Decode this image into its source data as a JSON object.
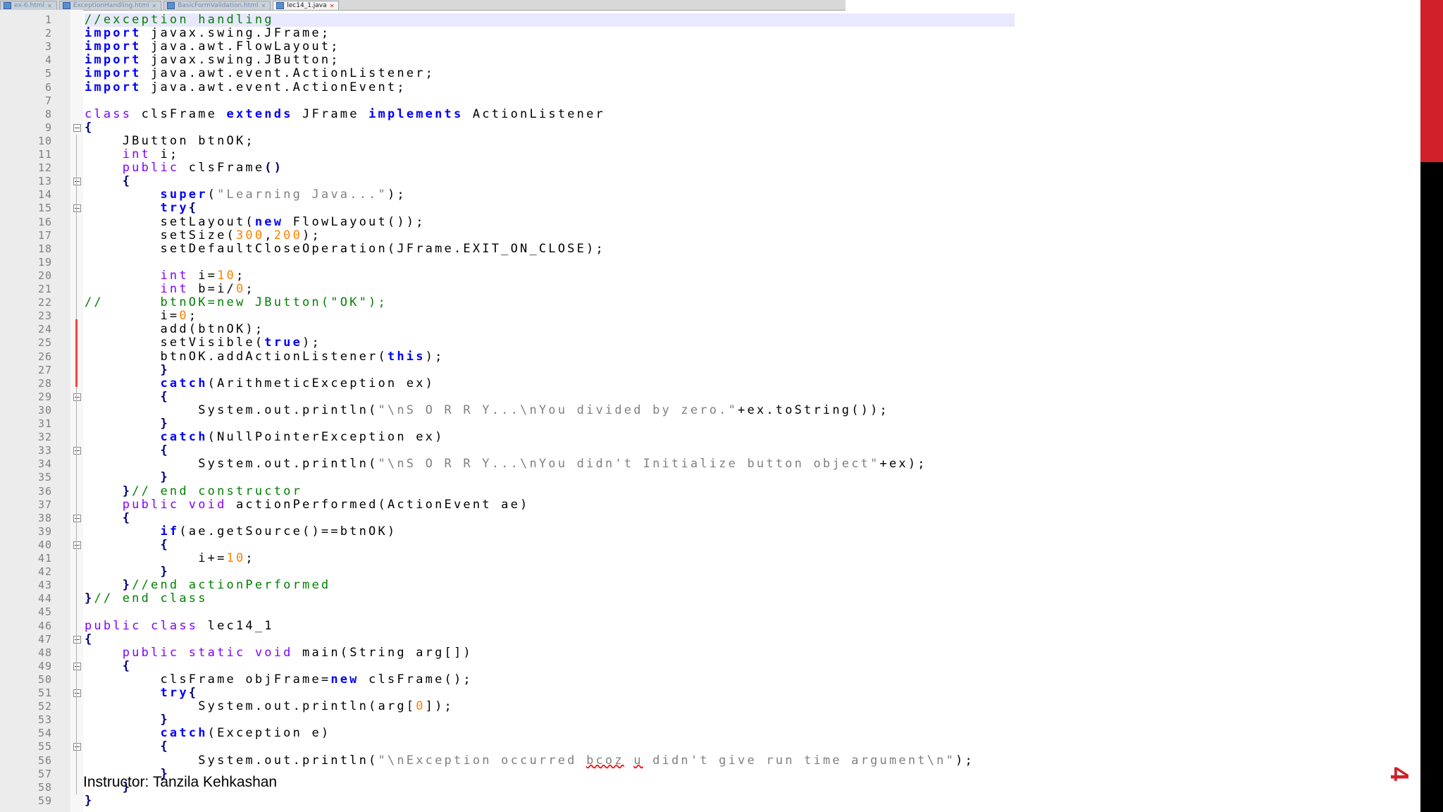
{
  "tabs": [
    {
      "label": "ex-6.html",
      "active": false
    },
    {
      "label": "ExceptionHandling.html",
      "active": false
    },
    {
      "label": "BasicFormValidation.html",
      "active": false
    },
    {
      "label": "lec14_1.java",
      "active": true
    }
  ],
  "icons": {
    "file": "file-icon",
    "close": "close-icon",
    "fold": "fold-marker-icon"
  },
  "colors": {
    "accent": "#d0202a",
    "keyword": "#0000ff",
    "string": "#808080",
    "number": "#ff8000",
    "comment": "#008000",
    "type": "#8000ff"
  },
  "code_lines": [
    [
      {
        "t": "//exception handling",
        "c": "cmt"
      }
    ],
    [
      {
        "t": "import",
        "c": "kw"
      },
      {
        "t": " javax.swing.JFrame;"
      }
    ],
    [
      {
        "t": "import",
        "c": "kw"
      },
      {
        "t": " java.awt.FlowLayout;"
      }
    ],
    [
      {
        "t": "import",
        "c": "kw"
      },
      {
        "t": " javax.swing.JButton;"
      }
    ],
    [
      {
        "t": "import",
        "c": "kw"
      },
      {
        "t": " java.awt.event.ActionListener;"
      }
    ],
    [
      {
        "t": "import",
        "c": "kw"
      },
      {
        "t": " java.awt.event.ActionEvent;"
      }
    ],
    [],
    [
      {
        "t": "class",
        "c": "type"
      },
      {
        "t": " clsFrame "
      },
      {
        "t": "extends",
        "c": "kw"
      },
      {
        "t": " JFrame "
      },
      {
        "t": "implements",
        "c": "kw"
      },
      {
        "t": " ActionListener"
      }
    ],
    [
      {
        "t": "{",
        "c": "op"
      }
    ],
    [
      {
        "t": "    JButton btnOK;"
      }
    ],
    [
      {
        "t": "    "
      },
      {
        "t": "int",
        "c": "type"
      },
      {
        "t": " i;"
      }
    ],
    [
      {
        "t": "    "
      },
      {
        "t": "public",
        "c": "type"
      },
      {
        "t": " clsFrame"
      },
      {
        "t": "()",
        "c": "op"
      }
    ],
    [
      {
        "t": "    "
      },
      {
        "t": "{",
        "c": "op"
      }
    ],
    [
      {
        "t": "        "
      },
      {
        "t": "super",
        "c": "kw"
      },
      {
        "t": "("
      },
      {
        "t": "\"Learning Java...\"",
        "c": "str"
      },
      {
        "t": ");"
      }
    ],
    [
      {
        "t": "        "
      },
      {
        "t": "try",
        "c": "kw"
      },
      {
        "t": "{",
        "c": "op"
      }
    ],
    [
      {
        "t": "        setLayout("
      },
      {
        "t": "new",
        "c": "kw"
      },
      {
        "t": " FlowLayout());"
      }
    ],
    [
      {
        "t": "        setSize("
      },
      {
        "t": "300",
        "c": "num"
      },
      {
        "t": ","
      },
      {
        "t": "200",
        "c": "num"
      },
      {
        "t": ");"
      }
    ],
    [
      {
        "t": "        setDefaultCloseOperation(JFrame.EXIT_ON_CLOSE);"
      }
    ],
    [],
    [
      {
        "t": "        "
      },
      {
        "t": "int",
        "c": "type"
      },
      {
        "t": " i="
      },
      {
        "t": "10",
        "c": "num"
      },
      {
        "t": ";"
      }
    ],
    [
      {
        "t": "        "
      },
      {
        "t": "int",
        "c": "type"
      },
      {
        "t": " b=i/"
      },
      {
        "t": "0",
        "c": "num"
      },
      {
        "t": ";"
      }
    ],
    [
      {
        "t": "//      btnOK=new JButton(\"OK\");",
        "c": "cmt"
      }
    ],
    [
      {
        "t": "        i="
      },
      {
        "t": "0",
        "c": "num"
      },
      {
        "t": ";"
      }
    ],
    [
      {
        "t": "        add(btnOK);"
      }
    ],
    [
      {
        "t": "        setVisible("
      },
      {
        "t": "true",
        "c": "kw"
      },
      {
        "t": ");"
      }
    ],
    [
      {
        "t": "        btnOK.addActionListener("
      },
      {
        "t": "this",
        "c": "kw"
      },
      {
        "t": ");"
      }
    ],
    [
      {
        "t": "        "
      },
      {
        "t": "}",
        "c": "op"
      }
    ],
    [
      {
        "t": "        "
      },
      {
        "t": "catch",
        "c": "kw"
      },
      {
        "t": "(ArithmeticException ex)"
      }
    ],
    [
      {
        "t": "        "
      },
      {
        "t": "{",
        "c": "op"
      }
    ],
    [
      {
        "t": "            System.out.println("
      },
      {
        "t": "\"\\nS O R R Y...\\nYou divided by zero.\"",
        "c": "str"
      },
      {
        "t": "+ex.toString());"
      }
    ],
    [
      {
        "t": "        "
      },
      {
        "t": "}",
        "c": "op"
      }
    ],
    [
      {
        "t": "        "
      },
      {
        "t": "catch",
        "c": "kw"
      },
      {
        "t": "(NullPointerException ex)"
      }
    ],
    [
      {
        "t": "        "
      },
      {
        "t": "{",
        "c": "op"
      }
    ],
    [
      {
        "t": "            System.out.println("
      },
      {
        "t": "\"\\nS O R R Y...\\nYou didn't Initialize button object\"",
        "c": "str"
      },
      {
        "t": "+ex);"
      }
    ],
    [
      {
        "t": "        "
      },
      {
        "t": "}",
        "c": "op"
      }
    ],
    [
      {
        "t": "    "
      },
      {
        "t": "}",
        "c": "op"
      },
      {
        "t": "// end constructor",
        "c": "cmt"
      }
    ],
    [
      {
        "t": "    "
      },
      {
        "t": "public",
        "c": "type"
      },
      {
        "t": " "
      },
      {
        "t": "void",
        "c": "type"
      },
      {
        "t": " actionPerformed(ActionEvent ae)"
      }
    ],
    [
      {
        "t": "    "
      },
      {
        "t": "{",
        "c": "op"
      }
    ],
    [
      {
        "t": "        "
      },
      {
        "t": "if",
        "c": "kw"
      },
      {
        "t": "(ae.getSource()==btnOK)"
      }
    ],
    [
      {
        "t": "        "
      },
      {
        "t": "{",
        "c": "op"
      }
    ],
    [
      {
        "t": "            i+="
      },
      {
        "t": "10",
        "c": "num"
      },
      {
        "t": ";"
      }
    ],
    [
      {
        "t": "        "
      },
      {
        "t": "}",
        "c": "op"
      }
    ],
    [
      {
        "t": "    "
      },
      {
        "t": "}",
        "c": "op"
      },
      {
        "t": "//end actionPerformed",
        "c": "cmt"
      }
    ],
    [
      {
        "t": "}",
        "c": "op"
      },
      {
        "t": "// end class",
        "c": "cmt"
      }
    ],
    [],
    [
      {
        "t": "public",
        "c": "type"
      },
      {
        "t": " "
      },
      {
        "t": "class",
        "c": "type"
      },
      {
        "t": " lec14_1"
      }
    ],
    [
      {
        "t": "{",
        "c": "op"
      }
    ],
    [
      {
        "t": "    "
      },
      {
        "t": "public",
        "c": "type"
      },
      {
        "t": " "
      },
      {
        "t": "static",
        "c": "type"
      },
      {
        "t": " "
      },
      {
        "t": "void",
        "c": "type"
      },
      {
        "t": " main(String arg[])"
      }
    ],
    [
      {
        "t": "    "
      },
      {
        "t": "{",
        "c": "op"
      }
    ],
    [
      {
        "t": "        clsFrame objFrame="
      },
      {
        "t": "new",
        "c": "kw"
      },
      {
        "t": " clsFrame();"
      }
    ],
    [
      {
        "t": "        "
      },
      {
        "t": "try",
        "c": "kw"
      },
      {
        "t": "{",
        "c": "op"
      }
    ],
    [
      {
        "t": "            System.out.println(arg["
      },
      {
        "t": "0",
        "c": "num"
      },
      {
        "t": "]);"
      }
    ],
    [
      {
        "t": "        "
      },
      {
        "t": "}",
        "c": "op"
      }
    ],
    [
      {
        "t": "        "
      },
      {
        "t": "catch",
        "c": "kw"
      },
      {
        "t": "(Exception e)"
      }
    ],
    [
      {
        "t": "        "
      },
      {
        "t": "{",
        "c": "op"
      }
    ],
    [
      {
        "t": "            System.out.println("
      },
      {
        "t": "\"\\nException occurred ",
        "c": "str"
      },
      {
        "t": "bcoz",
        "c": "str squig"
      },
      {
        "t": " ",
        "c": "str"
      },
      {
        "t": "u",
        "c": "str squig"
      },
      {
        "t": " didn't give run time argument\\n\"",
        "c": "str"
      },
      {
        "t": ");"
      }
    ],
    [
      {
        "t": "        "
      },
      {
        "t": "}",
        "c": "op"
      }
    ],
    [
      {
        "t": "    "
      },
      {
        "t": "}",
        "c": "op"
      }
    ],
    [
      {
        "t": "}",
        "c": "op"
      }
    ]
  ],
  "footer": {
    "instructor": "Instructor: Tanzila Kehkashan",
    "slide_number": "4"
  }
}
